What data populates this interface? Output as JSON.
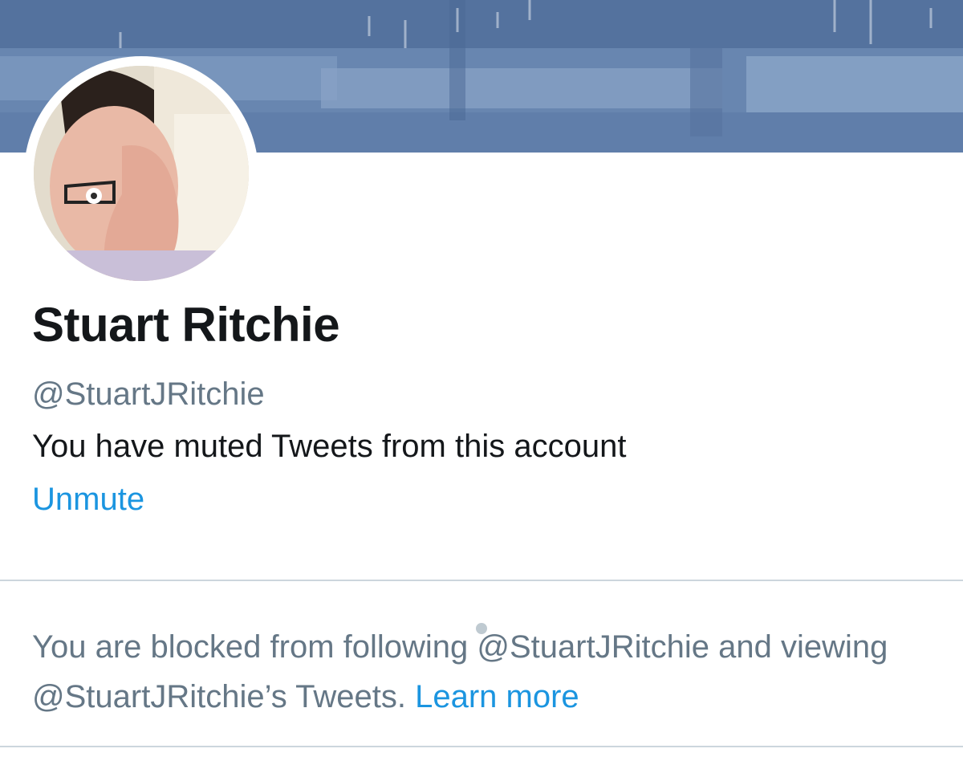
{
  "profile": {
    "display_name": "Stuart Ritchie",
    "handle": "@StuartJRitchie",
    "muted_notice": "You have muted Tweets from this account",
    "unmute_label": "Unmute"
  },
  "blocked_notice": {
    "text": "You are blocked from following @StuartJRitchie and viewing @StuartJRitchie’s Tweets. ",
    "learn_more_label": "Learn more"
  },
  "colors": {
    "link": "#1b95e0",
    "secondary_text": "#657786",
    "primary_text": "#14171a",
    "divider": "#ccd6dd",
    "banner": "#6d8ab3"
  },
  "icons": {
    "avatar": "profile-photo",
    "banner": "header-photo"
  }
}
